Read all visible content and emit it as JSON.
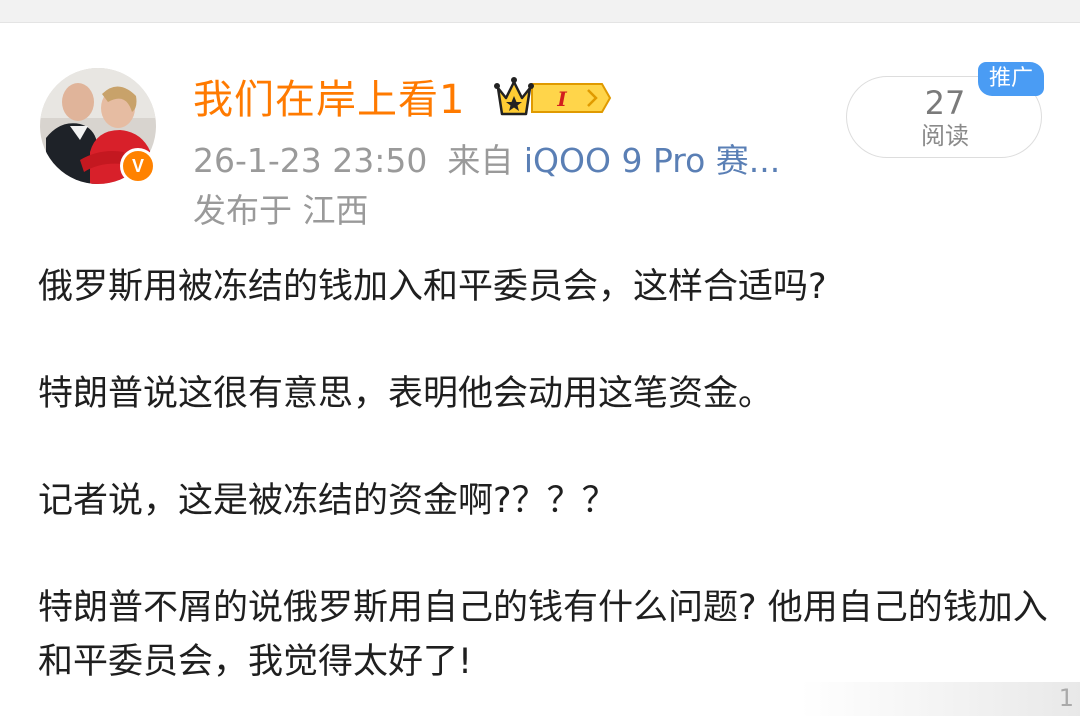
{
  "post": {
    "author": {
      "name": "我们在岸上看1",
      "verified_mark": "V",
      "badge_icon": "crown-level-badge-icon",
      "badge_level": "I"
    },
    "timestamp": "26-1-23 23:50",
    "source_prefix": "来自",
    "source_device": "iQOO 9 Pro 赛...",
    "location": "发布于 江西",
    "reads": {
      "count": "27",
      "label": "阅读"
    },
    "promo_tag": "推广",
    "paragraphs": [
      "俄罗斯用被冻结的钱加入和平委员会，这样合适吗?",
      "特朗普说这很有意思，表明他会动用这笔资金。",
      "记者说，这是被冻结的资金啊?？？？",
      "特朗普不屑的说俄罗斯用自己的钱有什么问题? 他用自己的钱加入和平委员会，我觉得太好了!"
    ],
    "watermark_char": "1"
  },
  "colors": {
    "username": "#ff7a00",
    "verified": "#ff8200",
    "meta": "#9a9a9a",
    "device_link": "#5a7fb5",
    "promo": "#4a9cf4",
    "badge_gold": "#f5b800"
  }
}
